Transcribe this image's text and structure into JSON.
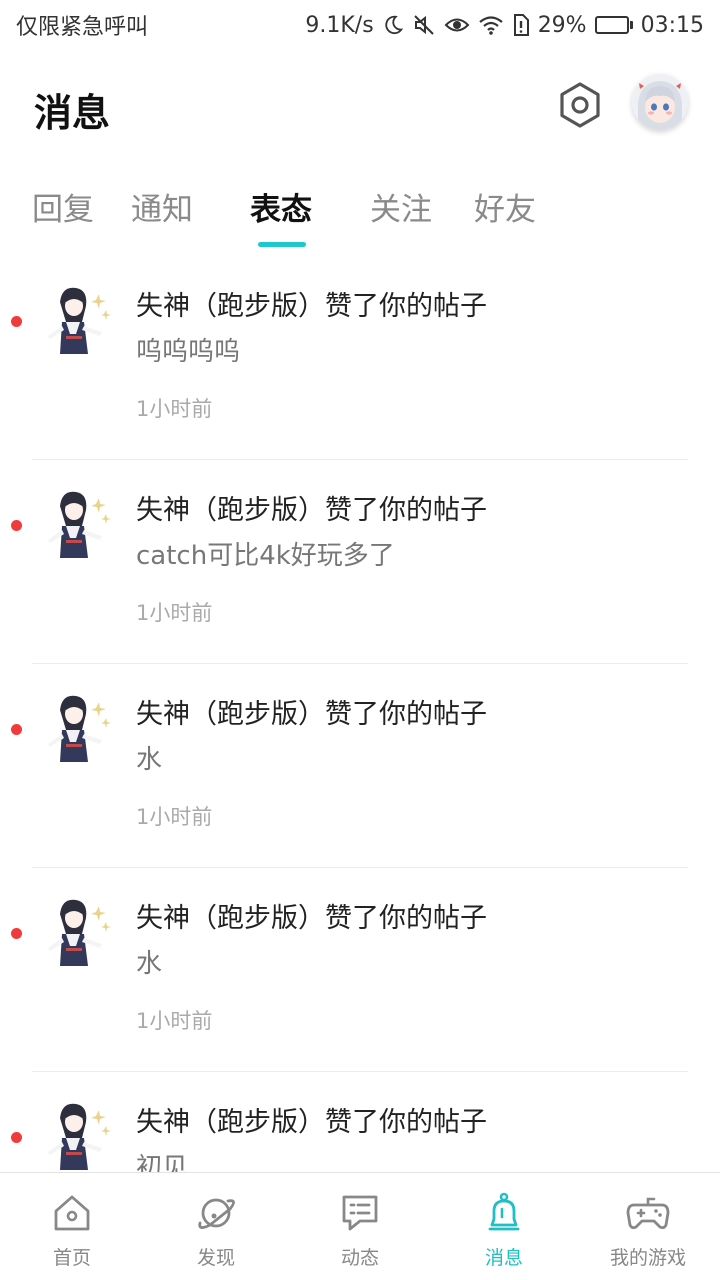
{
  "status_bar": {
    "left_text": "仅限紧急呼叫",
    "speed": "9.1K/s",
    "battery_percent": "29%",
    "battery_level": 0.29,
    "time": "03:15",
    "icons": [
      "moon-icon",
      "mute-icon",
      "eye-icon",
      "wifi-icon",
      "sim-alert-icon",
      "battery-icon"
    ]
  },
  "header": {
    "title": "消息",
    "settings_icon": "settings-hexagon-icon",
    "avatar_icon": "user-avatar"
  },
  "tabs": [
    {
      "label": "回复",
      "active": false
    },
    {
      "label": "通知",
      "active": false
    },
    {
      "label": "表态",
      "active": true
    },
    {
      "label": "关注",
      "active": false
    },
    {
      "label": "好友",
      "active": false
    }
  ],
  "messages": [
    {
      "title": "失神（跑步版）赞了你的帖子",
      "content": "呜呜呜呜",
      "time": "1小时前",
      "unread": true
    },
    {
      "title": "失神（跑步版）赞了你的帖子",
      "content": "catch可比4k好玩多了",
      "time": "1小时前",
      "unread": true
    },
    {
      "title": "失神（跑步版）赞了你的帖子",
      "content": "水",
      "time": "1小时前",
      "unread": true
    },
    {
      "title": "失神（跑步版）赞了你的帖子",
      "content": "水",
      "time": "1小时前",
      "unread": true
    },
    {
      "title": "失神（跑步版）赞了你的帖子",
      "content": "初见",
      "time": "",
      "unread": true
    }
  ],
  "bottom_nav": [
    {
      "label": "首页",
      "icon": "home-icon",
      "active": false
    },
    {
      "label": "发现",
      "icon": "planet-icon",
      "active": false
    },
    {
      "label": "动态",
      "icon": "chat-icon",
      "active": false
    },
    {
      "label": "消息",
      "icon": "bell-icon",
      "active": true
    },
    {
      "label": "我的游戏",
      "icon": "gamepad-icon",
      "active": false
    }
  ],
  "colors": {
    "accent": "#1fc8cc",
    "unread_dot": "#ef3b3b",
    "battery_fill": "#2fc24a"
  }
}
